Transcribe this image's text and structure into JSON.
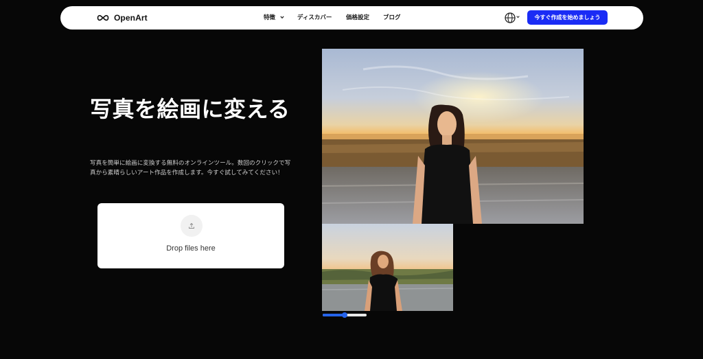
{
  "nav": {
    "brand": "OpenArt",
    "links": [
      "特徴",
      "ディスカバー",
      "価格設定",
      "ブログ"
    ],
    "cta": "今すぐ作成を始めましょう"
  },
  "hero": {
    "title": "写真を絵画に変える",
    "description": "写真を簡単に絵画に変換する無料のオンラインツール。数回のクリックで写真から素晴らしいアート作品を作成します。今すぐ試してみてください！"
  },
  "upload": {
    "label": "Drop files here"
  },
  "comparison_slider": {
    "value": 0.5
  },
  "colors": {
    "background": "#070707",
    "accent": "#1a2cf5",
    "slider": "#2563eb"
  },
  "icons": {
    "brand": "infinity-logo-icon",
    "features_menu": "chevron-down-icon",
    "language": "globe-icon",
    "upload": "upload-icon"
  }
}
